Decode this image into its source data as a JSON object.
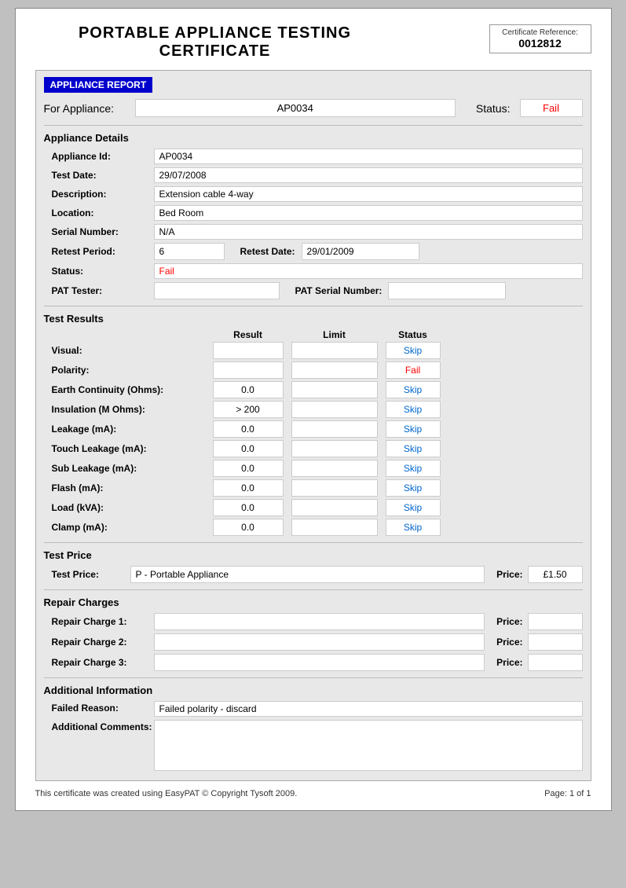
{
  "header": {
    "title": "PORTABLE APPLIANCE TESTING CERTIFICATE",
    "cert_ref_label": "Certificate Reference:",
    "cert_ref_number": "0012812"
  },
  "appliance_report": {
    "section_label": "APPLIANCE REPORT",
    "for_appliance_label": "For Appliance:",
    "appliance_id": "AP0034",
    "status_label": "Status:",
    "status_value": "Fail"
  },
  "appliance_details": {
    "section_title": "Appliance Details",
    "fields": [
      {
        "label": "Appliance Id:",
        "value": "AP0034"
      },
      {
        "label": "Test Date:",
        "value": "29/07/2008"
      },
      {
        "label": "Description:",
        "value": "Extension cable 4-way"
      },
      {
        "label": "Location:",
        "value": "Bed Room"
      },
      {
        "label": "Serial Number:",
        "value": "N/A"
      }
    ],
    "retest_period_label": "Retest Period:",
    "retest_period_value": "6",
    "retest_date_label": "Retest Date:",
    "retest_date_value": "29/01/2009",
    "status_label": "Status:",
    "status_value": "Fail",
    "pat_tester_label": "PAT Tester:",
    "pat_tester_value": "",
    "pat_serial_label": "PAT Serial Number:",
    "pat_serial_value": ""
  },
  "test_results": {
    "section_title": "Test Results",
    "col_result": "Result",
    "col_limit": "Limit",
    "col_status": "Status",
    "rows": [
      {
        "label": "Visual:",
        "result": "",
        "limit": "",
        "status": "Skip",
        "status_type": "skip"
      },
      {
        "label": "Polarity:",
        "result": "",
        "limit": "",
        "status": "Fail",
        "status_type": "fail"
      },
      {
        "label": "Earth Continuity (Ohms):",
        "result": "0.0",
        "limit": "",
        "status": "Skip",
        "status_type": "skip"
      },
      {
        "label": "Insulation (M Ohms):",
        "result": "> 200",
        "limit": "",
        "status": "Skip",
        "status_type": "skip"
      },
      {
        "label": "Leakage (mA):",
        "result": "0.0",
        "limit": "",
        "status": "Skip",
        "status_type": "skip"
      },
      {
        "label": "Touch Leakage (mA):",
        "result": "0.0",
        "limit": "",
        "status": "Skip",
        "status_type": "skip"
      },
      {
        "label": "Sub Leakage (mA):",
        "result": "0.0",
        "limit": "",
        "status": "Skip",
        "status_type": "skip"
      },
      {
        "label": "Flash (mA):",
        "result": "0.0",
        "limit": "",
        "status": "Skip",
        "status_type": "skip"
      },
      {
        "label": "Load (kVA):",
        "result": "0.0",
        "limit": "",
        "status": "Skip",
        "status_type": "skip"
      },
      {
        "label": "Clamp (mA):",
        "result": "0.0",
        "limit": "",
        "status": "Skip",
        "status_type": "skip"
      }
    ]
  },
  "test_price": {
    "section_title": "Test Price",
    "price_label": "Test Price:",
    "price_desc": "P - Portable Appliance",
    "price_amount_label": "Price:",
    "price_amount": "£1.50"
  },
  "repair_charges": {
    "section_title": "Repair Charges",
    "rows": [
      {
        "label": "Repair Charge 1:",
        "desc": "",
        "price_label": "Price:",
        "price": ""
      },
      {
        "label": "Repair Charge 2:",
        "desc": "",
        "price_label": "Price:",
        "price": ""
      },
      {
        "label": "Repair Charge 3:",
        "desc": "",
        "price_label": "Price:",
        "price": ""
      }
    ]
  },
  "additional_info": {
    "section_title": "Additional Information",
    "failed_reason_label": "Failed Reason:",
    "failed_reason_value": "Failed polarity - discard",
    "additional_comments_label": "Additional Comments:",
    "additional_comments_value": ""
  },
  "footer": {
    "left": "This certificate was created using EasyPAT © Copyright Tysoft 2009.",
    "right": "Page: 1 of 1"
  }
}
